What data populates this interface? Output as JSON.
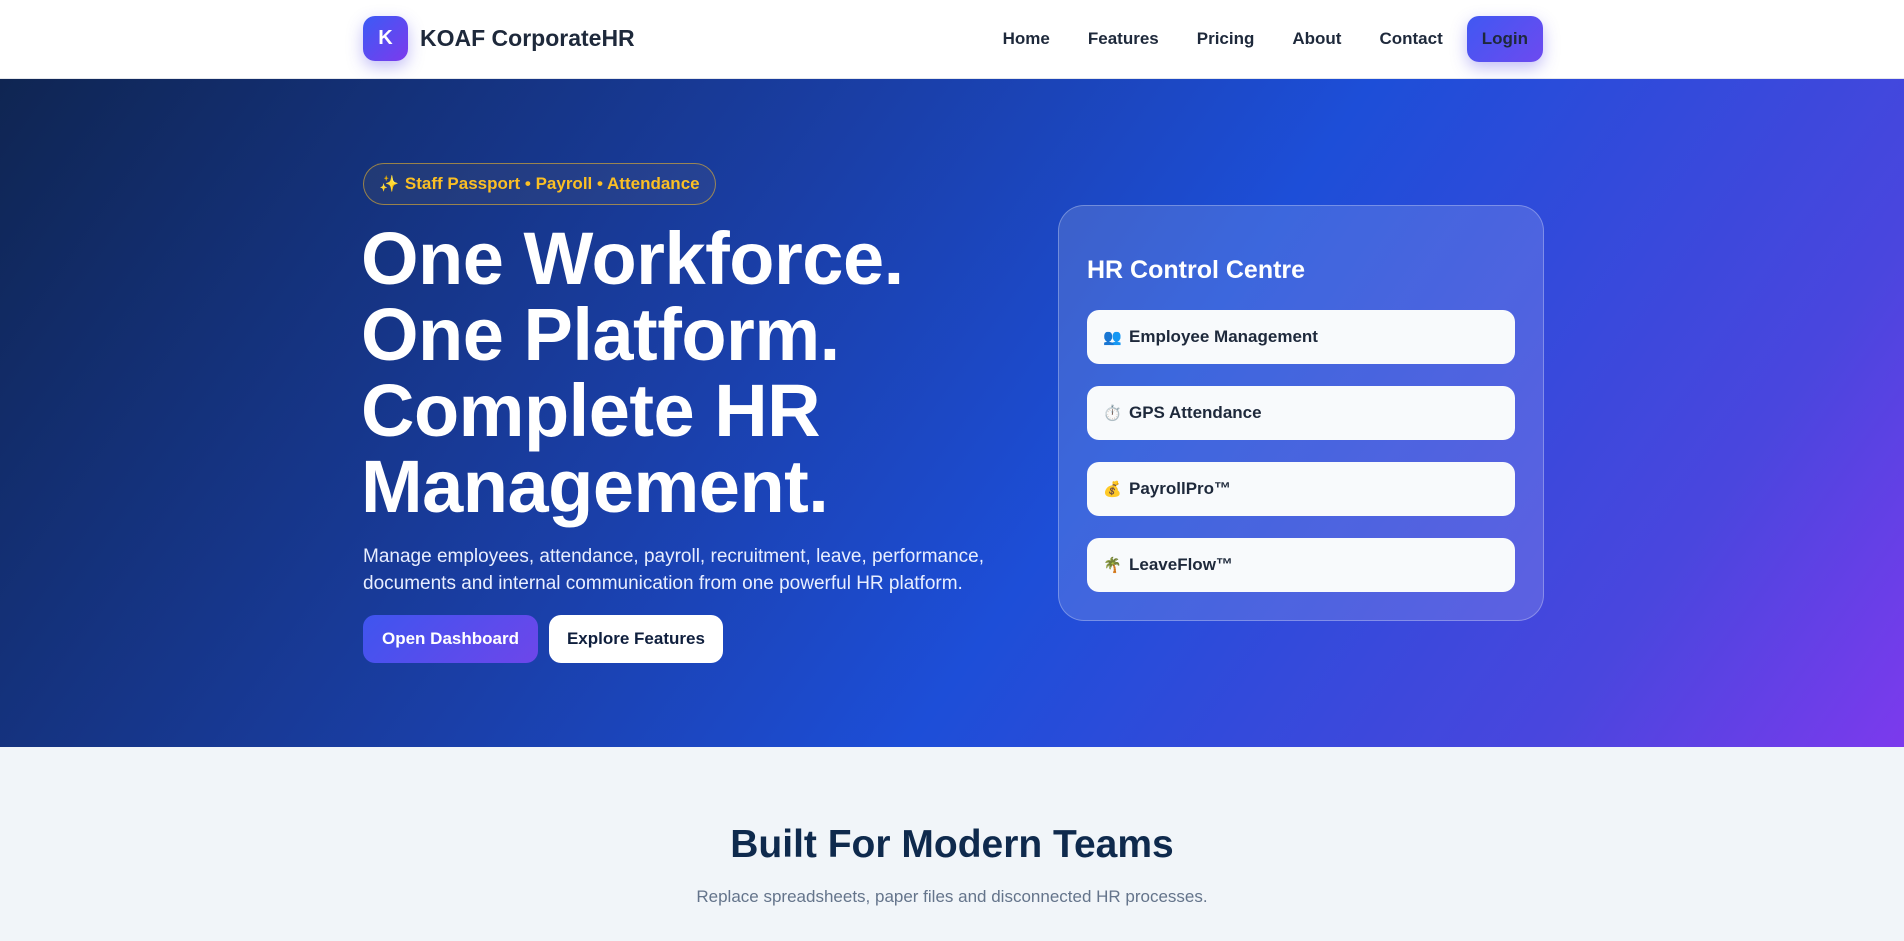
{
  "brand": {
    "logo_letter": "K",
    "name": "KOAF CorporateHR"
  },
  "nav": {
    "items": [
      {
        "label": "Home"
      },
      {
        "label": "Features"
      },
      {
        "label": "Pricing"
      },
      {
        "label": "About"
      },
      {
        "label": "Contact"
      }
    ],
    "login_label": "Login"
  },
  "hero": {
    "badge_icon": "sparkles-icon",
    "badge_glyph": "✨",
    "badge_text": "Staff Passport • Payroll • Attendance",
    "headline_lines": [
      "One Workforce.",
      "One Platform.",
      "Complete HR",
      "Management."
    ],
    "subtitle": "Manage employees, attendance, payroll, recruitment, leave, performance, documents and internal communication from one powerful HR platform.",
    "primary_cta": "Open Dashboard",
    "secondary_cta": "Explore Features"
  },
  "panel": {
    "title": "HR Control Centre",
    "items": [
      {
        "icon": "people-icon",
        "glyph": "👥",
        "label": "Employee Management"
      },
      {
        "icon": "stopwatch-icon",
        "glyph": "⏱️",
        "label": "GPS Attendance"
      },
      {
        "icon": "money-bag-icon",
        "glyph": "💰",
        "label": "PayrollPro™"
      },
      {
        "icon": "palm-tree-icon",
        "glyph": "🌴",
        "label": "LeaveFlow™"
      }
    ]
  },
  "section": {
    "title": "Built For Modern Teams",
    "subtitle": "Replace spreadsheets, paper files and disconnected HR processes."
  },
  "colors": {
    "accent_gradient_start": "#3b5bf5",
    "accent_gradient_end": "#7c3aed",
    "badge": "#fbbf24",
    "hero_dark": "#0f2552",
    "hero_blue": "#1d4ed8"
  }
}
